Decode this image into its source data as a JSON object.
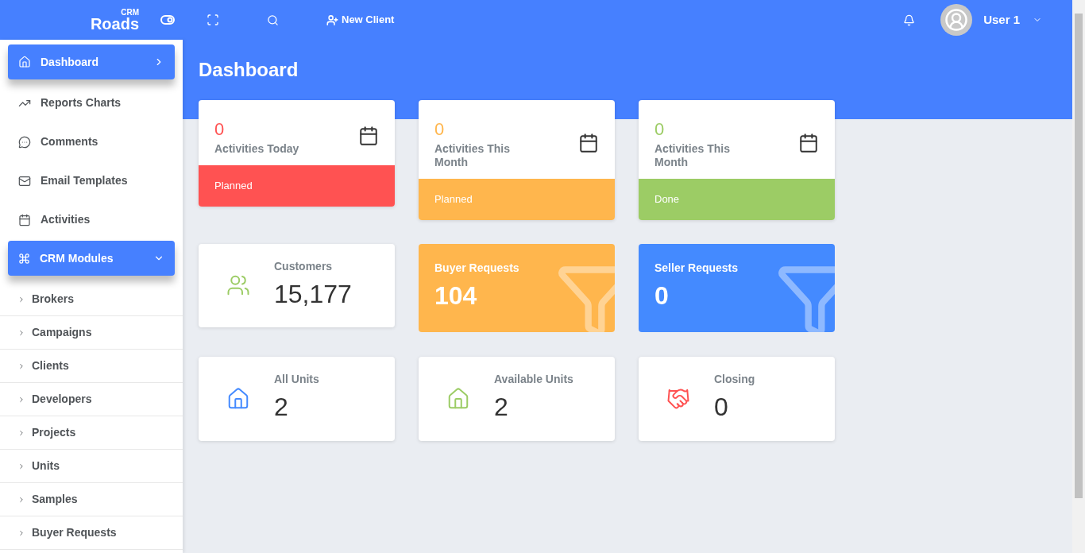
{
  "header": {
    "logo": {
      "word": "Roads",
      "superscript": "CRM"
    },
    "new_client": "New Client",
    "user": "User 1"
  },
  "sidebar": {
    "items": [
      {
        "label": "Dashboard",
        "selected": true
      },
      {
        "label": "Reports Charts",
        "selected": false
      },
      {
        "label": "Comments",
        "selected": false
      },
      {
        "label": "Email Templates",
        "selected": false
      },
      {
        "label": "Activities",
        "selected": false
      }
    ],
    "modules": {
      "label": "CRM Modules",
      "expanded": true,
      "children": [
        "Brokers",
        "Campaigns",
        "Clients",
        "Developers",
        "Projects",
        "Units",
        "Samples",
        "Buyer Requests"
      ]
    }
  },
  "page_title": "Dashboard",
  "activity_cards": [
    {
      "value": "0",
      "label": "Activities Today",
      "footer": "Planned",
      "color": "#ff5252"
    },
    {
      "value": "0",
      "label": "Activities This Month",
      "footer": "Planned",
      "color": "#ffb64d"
    },
    {
      "value": "0",
      "label": "Activities This Month",
      "footer": "Done",
      "color": "#9ccc65"
    }
  ],
  "stat_cards": [
    {
      "kind": "plain",
      "label": "Customers",
      "value": "15,177",
      "color": "#9ccc65"
    },
    {
      "kind": "filled",
      "label": "Buyer Requests",
      "value": "104",
      "color": "#ffb64d"
    },
    {
      "kind": "filled",
      "label": "Seller Requests",
      "value": "0",
      "color": "#448aff"
    },
    {
      "kind": "plain",
      "label": "All Units",
      "value": "2",
      "color": "#448aff"
    },
    {
      "kind": "plain",
      "label": "Available Units",
      "value": "2",
      "color": "#9ccc65"
    },
    {
      "kind": "plain",
      "label": "Closing",
      "value": "0",
      "color": "#ff5252"
    }
  ]
}
